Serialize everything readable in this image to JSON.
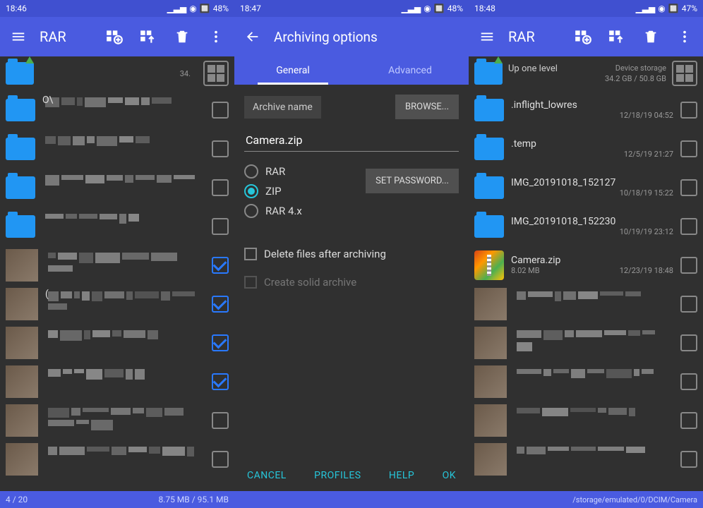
{
  "status": {
    "time1": "18:46",
    "time2": "18:47",
    "time3": "18:48",
    "battery1": "48",
    "battery2": "48",
    "battery3": "47",
    "pct": "%"
  },
  "app_title": "RAR",
  "screen1": {
    "uprow_sub": "34.",
    "items": [
      {
        "name": "O\\",
        "checked": false,
        "type": "folder"
      },
      {
        "name": "",
        "checked": false,
        "type": "folder"
      },
      {
        "name": "",
        "checked": false,
        "type": "folder"
      },
      {
        "name": "",
        "checked": false,
        "type": "folder"
      },
      {
        "name": "",
        "checked": true,
        "type": "thumb"
      },
      {
        "name": "(",
        "checked": true,
        "type": "thumb"
      },
      {
        "name": "",
        "checked": true,
        "type": "thumb"
      },
      {
        "name": "",
        "checked": true,
        "type": "thumb"
      },
      {
        "name": "",
        "checked": false,
        "type": "thumb"
      },
      {
        "name": "",
        "checked": false,
        "type": "thumb"
      }
    ],
    "footer_left": "4 / 20",
    "footer_right": "8.75 MB / 95.1 MB"
  },
  "screen2": {
    "title": "Archiving options",
    "tab_general": "General",
    "tab_advanced": "Advanced",
    "archive_name_label": "Archive name",
    "browse_btn": "BROWSE...",
    "archive_name_value": "Camera.zip",
    "fmt_rar": "RAR",
    "fmt_zip": "ZIP",
    "fmt_rar4": "RAR 4.x",
    "set_password_btn": "SET PASSWORD...",
    "delete_after": "Delete files after archiving",
    "solid_archive": "Create solid archive",
    "cancel": "CANCEL",
    "profiles": "PROFILES",
    "help": "HELP",
    "ok": "OK"
  },
  "screen3": {
    "uprow_label": "Up one level",
    "uprow_storage": "Device storage",
    "uprow_size": "34.2 GB / 50.8 GB",
    "items": [
      {
        "name": ".inflight_lowres",
        "meta": "12/18/19 04:52",
        "type": "folder"
      },
      {
        "name": ".temp",
        "meta": "12/5/19 21:27",
        "type": "folder"
      },
      {
        "name": "IMG_20191018_152127",
        "meta": "10/18/19 15:22",
        "type": "folder"
      },
      {
        "name": "IMG_20191018_152230",
        "meta": "10/19/19 23:12",
        "type": "folder"
      },
      {
        "name": "Camera.zip",
        "size": "8.02 MB",
        "meta": "12/23/19 18:48",
        "type": "zip"
      },
      {
        "name": "",
        "meta": "",
        "type": "thumb"
      },
      {
        "name": "",
        "meta": "",
        "type": "thumb"
      },
      {
        "name": "",
        "meta": "",
        "type": "thumb"
      },
      {
        "name": "",
        "meta": "",
        "type": "thumb"
      },
      {
        "name": "",
        "meta": "",
        "type": "thumb"
      }
    ],
    "footer_path": "/storage/emulated/0/DCIM/Camera"
  }
}
